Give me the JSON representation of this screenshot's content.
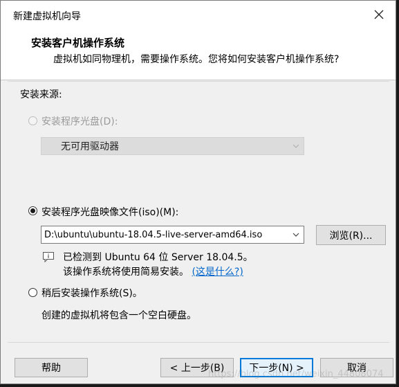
{
  "window": {
    "title": "新建虚拟机向导"
  },
  "header": {
    "title": "安装客户机操作系统",
    "subtitle": "虚拟机如同物理机，需要操作系统。您将如何安装客户机操作系统?"
  },
  "install_source": {
    "label": "安装来源:",
    "option_disc": {
      "label": "安装程序光盘(D):",
      "enabled": false,
      "selected": false
    },
    "drive_select": {
      "value": "无可用驱动器",
      "enabled": false
    },
    "option_iso": {
      "label": "安装程序光盘映像文件(iso)(M):",
      "enabled": true,
      "selected": true
    },
    "iso_path": {
      "value": "D:\\ubuntu\\ubuntu-18.04.5-live-server-amd64.iso"
    },
    "browse_label": "浏览(R)...",
    "detected": {
      "line1": "已检测到 Ubuntu 64 位 Server 18.04.5。",
      "line2_prefix": "该操作系统将使用简易安装。",
      "link": "(这是什么?)"
    },
    "option_later": {
      "label": "稍后安装操作系统(S)。",
      "enabled": true,
      "selected": false
    },
    "later_desc": "创建的虚拟机将包含一个空白硬盘。"
  },
  "footer": {
    "help_label": "帮助",
    "back_label": "< 上一步(B)",
    "next_label": "下一步(N) >",
    "cancel_label": "取消"
  },
  "watermark": "https://blog.csdn.net/weixin_44808074"
}
